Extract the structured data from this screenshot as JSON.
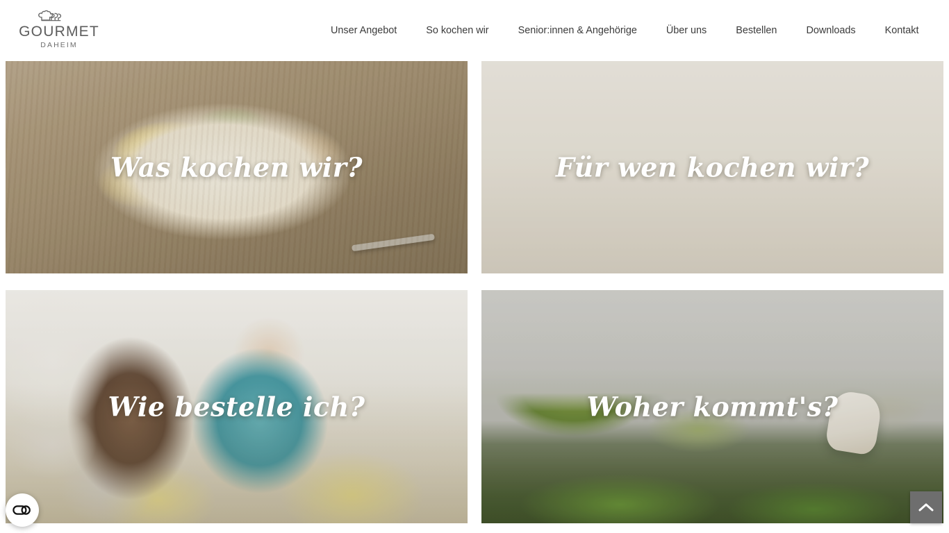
{
  "header": {
    "logo": {
      "word": "GOURMET",
      "sub": "DAHEIM",
      "icon": "chef-hats-icon"
    },
    "nav": [
      {
        "label": "Unser Angebot"
      },
      {
        "label": "So kochen wir"
      },
      {
        "label": "Senior:innen & Angehörige"
      },
      {
        "label": "Über uns"
      },
      {
        "label": "Bestellen"
      },
      {
        "label": "Downloads"
      },
      {
        "label": "Kontakt"
      }
    ]
  },
  "tiles": [
    {
      "label": "Was kochen wir?",
      "image": "plated-pork-with-potatoes-photo"
    },
    {
      "label": "Für wen kochen wir?",
      "image": "seniors-playing-cards-photo"
    },
    {
      "label": "Wie bestelle ich?",
      "image": "senior-man-reading-brochure-photo"
    },
    {
      "label": "Woher kommt's?",
      "image": "vegetable-field-harvest-photo"
    }
  ],
  "widgets": {
    "accessibility_label": "accessibility-widget",
    "scroll_top_label": "scroll-to-top"
  },
  "colors": {
    "nav_text": "#3b3b3b",
    "logo_text": "#5d5d5d",
    "tile_label": "#ffffff",
    "scroll_top_bg": "#6e6e6e",
    "page_bg": "#ffffff"
  }
}
